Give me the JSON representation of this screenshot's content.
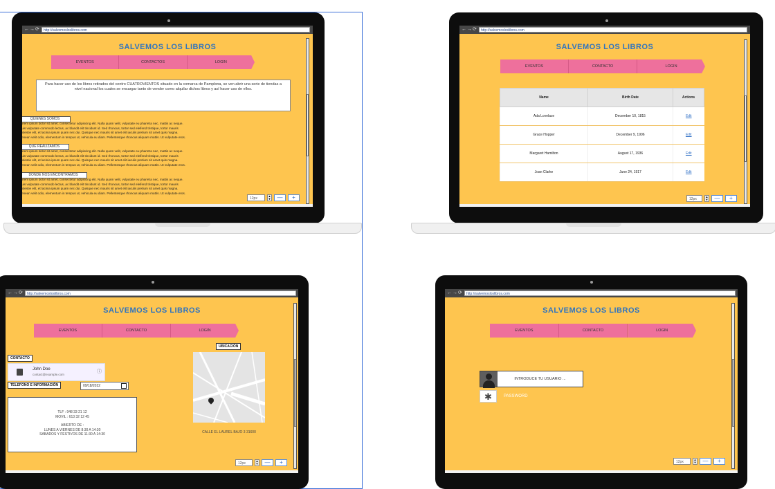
{
  "site": {
    "url": "http://salvemosloslibros.com",
    "title": "SALVEMOS LOS LIBROS"
  },
  "screen1": {
    "nav": [
      "EVENTOS",
      "CONTACTOS",
      "LOGIN"
    ],
    "intro": "Para hacer uso de los libros retirados del centro CUATROVIENTOS situado en la comarca de Pamplona, se ven abrir una serie de tiendas a nivel nacional los cuales se encargar tanto de vender como alquilar dichos libros y así hacer uso de ellos.",
    "sections": [
      {
        "label": "QUIENES SOMOS"
      },
      {
        "label": "QUE REALIZAMOS"
      },
      {
        "label": "DONDE NOS ENCONTRAMOS"
      }
    ],
    "lorem": "Lorem ipsum dolor sit amet, consectetur adipiscing elit. Nulla quam velit, vulputate eu pharetra nec, mattis ac neque.\nDuis vulputate commodo lectus, ac blandit elit tincidunt id. Sed rhoncus, tortor sed eleifend tristique, tortor mauris\nmolestie elit, et lacinia ipsum quam nec dui. Quisque nec mauris sit amet elit iaculis pretium sit amet quis magna.\nAenean velit odio, elementum in tempus ut, vehicula eu diam. Pellentesque rhoncus aliquam mattis. Ut vulputate eros.",
    "zoom": "12px"
  },
  "screen2": {
    "nav": [
      "EVENTOS",
      "CONTACTO",
      "LOGIN"
    ],
    "table": {
      "headers": [
        "Name",
        "Birth Date",
        "Actions"
      ],
      "rows": [
        [
          "Ada Lovelace",
          "December 10, 1815",
          "Edit"
        ],
        [
          "Grace Hopper",
          "December 9, 1906",
          "Edit"
        ],
        [
          "Margaret Hamilton",
          "August 17, 1936",
          "Edit"
        ],
        [
          "Joan Clarke",
          "June 24, 1917",
          "Edit"
        ]
      ]
    },
    "zoom": "12px"
  },
  "screen3": {
    "nav": [
      "EVENTOS",
      "CONTACTO",
      "LOGIN"
    ],
    "contact_label": "CONTACTO",
    "contact_name": "John Doe",
    "contact_email": "contact@example.com",
    "phone_label": "TELEFONO E INFORMACIÓN",
    "date_value": "09/18/2022",
    "info_lines": [
      "TLF : 948 33 21 12",
      "MOVIL : 613 32 12 45",
      "",
      "ABIERTO DE :",
      "LUNES A VIERNES DE 8:30 A 14:30",
      "SABADOS Y FESTIVOS DE 11:30 A 14:30"
    ],
    "location_label": "UBICACIÓN",
    "address": "CALLE EL LAUREL BAJO 3 31600",
    "zoom": "12px"
  },
  "screen4": {
    "nav": [
      "EVENTOS",
      "CONTACTO",
      "LOGIN"
    ],
    "user_placeholder": "INTRODUCE TU USUARIO ...",
    "password_placeholder": "PASSWORD",
    "zoom": "12px"
  },
  "colors": {
    "page_bg": "#fec54f",
    "nav_pink": "#ee709c",
    "title_blue": "#2f74c0"
  },
  "icons": [
    "back-arrow-icon",
    "forward-arrow-icon",
    "refresh-icon",
    "contact-card-icon",
    "info-icon",
    "calendar-icon",
    "map-pin-icon",
    "user-silhouette-icon",
    "asterisk-icon"
  ]
}
